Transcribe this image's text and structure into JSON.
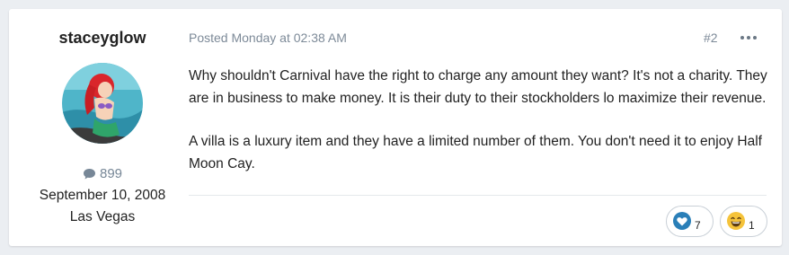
{
  "author": {
    "username": "staceyglow",
    "post_count": "899",
    "joined": "September 10, 2008",
    "location": "Las Vegas"
  },
  "post": {
    "meta": "Posted Monday at 02:38 AM",
    "number": "#2",
    "paragraphs": [
      "Why shouldn't Carnival have the right to charge any amount they want? It's not a charity. They are in business to make money. It is their duty to their stockholders lo maximize their revenue.",
      "A villa is a luxury item and they have a limited number of them. You don't need it to enjoy Half Moon Cay."
    ]
  },
  "reactions": [
    {
      "icon": "heart-icon",
      "count": "7",
      "color": "#2a7fb8"
    },
    {
      "icon": "laughing-emoji-icon",
      "count": "1",
      "color": "#f5c33b"
    }
  ],
  "colors": {
    "background": "#ebeef2",
    "meta_text": "#7d8a98",
    "accent": "#2a7fb8"
  }
}
